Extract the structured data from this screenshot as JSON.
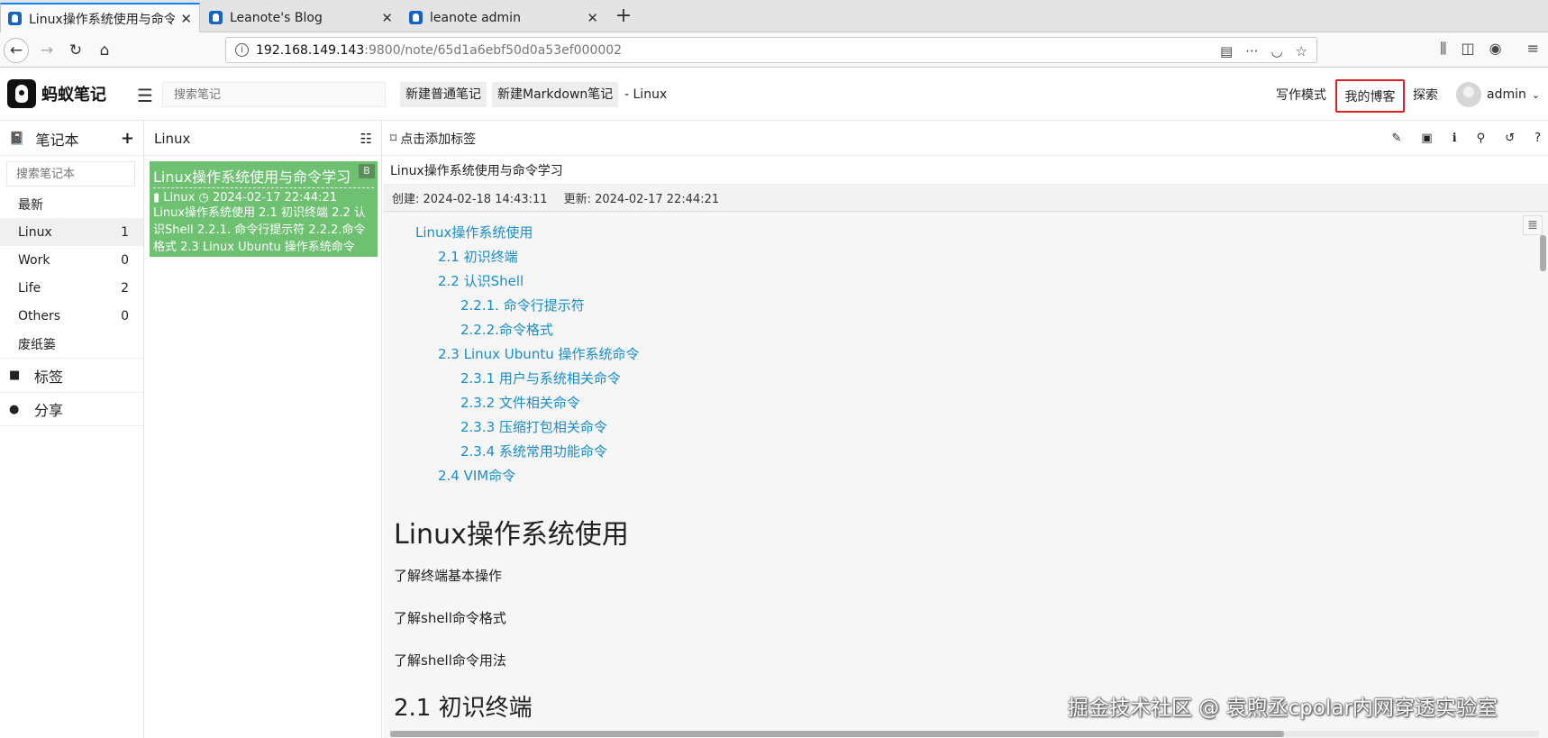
{
  "browser": {
    "tabs": [
      {
        "title": "Linux操作系统使用与命令学习"
      },
      {
        "title": "Leanote's Blog"
      },
      {
        "title": "leanote admin"
      }
    ],
    "close_glyph": "✕",
    "new_tab_glyph": "+",
    "url_host": "192.168.149.143",
    "url_path": ":9800/note/65d1a6ebf50d0a53ef000002"
  },
  "header": {
    "logo_text": "蚂蚁笔记",
    "search_placeholder": "搜索笔记",
    "new_note_label": "新建普通笔记",
    "new_markdown_label": "新建Markdown笔记",
    "current_notebook": "- Linux",
    "write_mode_label": "写作模式",
    "my_blog_label": "我的博客",
    "explore_label": "探索",
    "user_name": "admin"
  },
  "sidebar": {
    "title": "笔记本",
    "search_placeholder": "搜索笔记本",
    "notebooks": [
      {
        "label": "最新",
        "count": ""
      },
      {
        "label": "Linux",
        "count": "1"
      },
      {
        "label": "Work",
        "count": "0"
      },
      {
        "label": "Life",
        "count": "2"
      },
      {
        "label": "Others",
        "count": "0"
      },
      {
        "label": "废纸篓",
        "count": ""
      }
    ],
    "tags_label": "标签",
    "share_label": "分享"
  },
  "note_list": {
    "title": "Linux",
    "notes": [
      {
        "title": "Linux操作系统使用与命令学习",
        "badge": "B",
        "notebook": "Linux",
        "date": "2024-02-17 22:44:21",
        "summary": "Linux操作系统使用 2.1 初识终端 2.2 认识Shell 2.2.1. 命令行提示符 2.2.2.命令格式 2.3 Linux Ubuntu 操作系统命令"
      }
    ]
  },
  "editor": {
    "add_tag_label": "点击添加标签",
    "note_title": "Linux操作系统使用与命令学习",
    "created": "创建: 2024-02-18 14:43:11",
    "updated": "更新: 2024-02-17 22:44:21",
    "toc": [
      {
        "text": "Linux操作系统使用",
        "level": 1
      },
      {
        "text": "2.1 初识终端",
        "level": 2
      },
      {
        "text": "2.2 认识Shell",
        "level": 2
      },
      {
        "text": "2.2.1. 命令行提示符",
        "level": 3
      },
      {
        "text": "2.2.2.命令格式",
        "level": 3
      },
      {
        "text": "2.3 Linux Ubuntu 操作系统命令",
        "level": 2
      },
      {
        "text": "2.3.1 用户与系统相关命令",
        "level": 3
      },
      {
        "text": "2.3.2 文件相关命令",
        "level": 3
      },
      {
        "text": "2.3.3 压缩打包相关命令",
        "level": 3
      },
      {
        "text": "2.3.4 系统常用功能命令",
        "level": 3
      },
      {
        "text": "2.4 VIM命令",
        "level": 2
      }
    ],
    "heading1": "Linux操作系统使用",
    "paragraphs": [
      "了解终端基本操作",
      "了解shell命令格式",
      "了解shell命令用法"
    ],
    "heading2": "2.1 初识终端"
  },
  "watermark": "掘金技术社区 @ 袁煦丞cpolar内网穿透实验室",
  "colors": {
    "accent_green": "#6dc171",
    "link_blue": "#1a8dc7",
    "highlight_red": "#e02020"
  }
}
